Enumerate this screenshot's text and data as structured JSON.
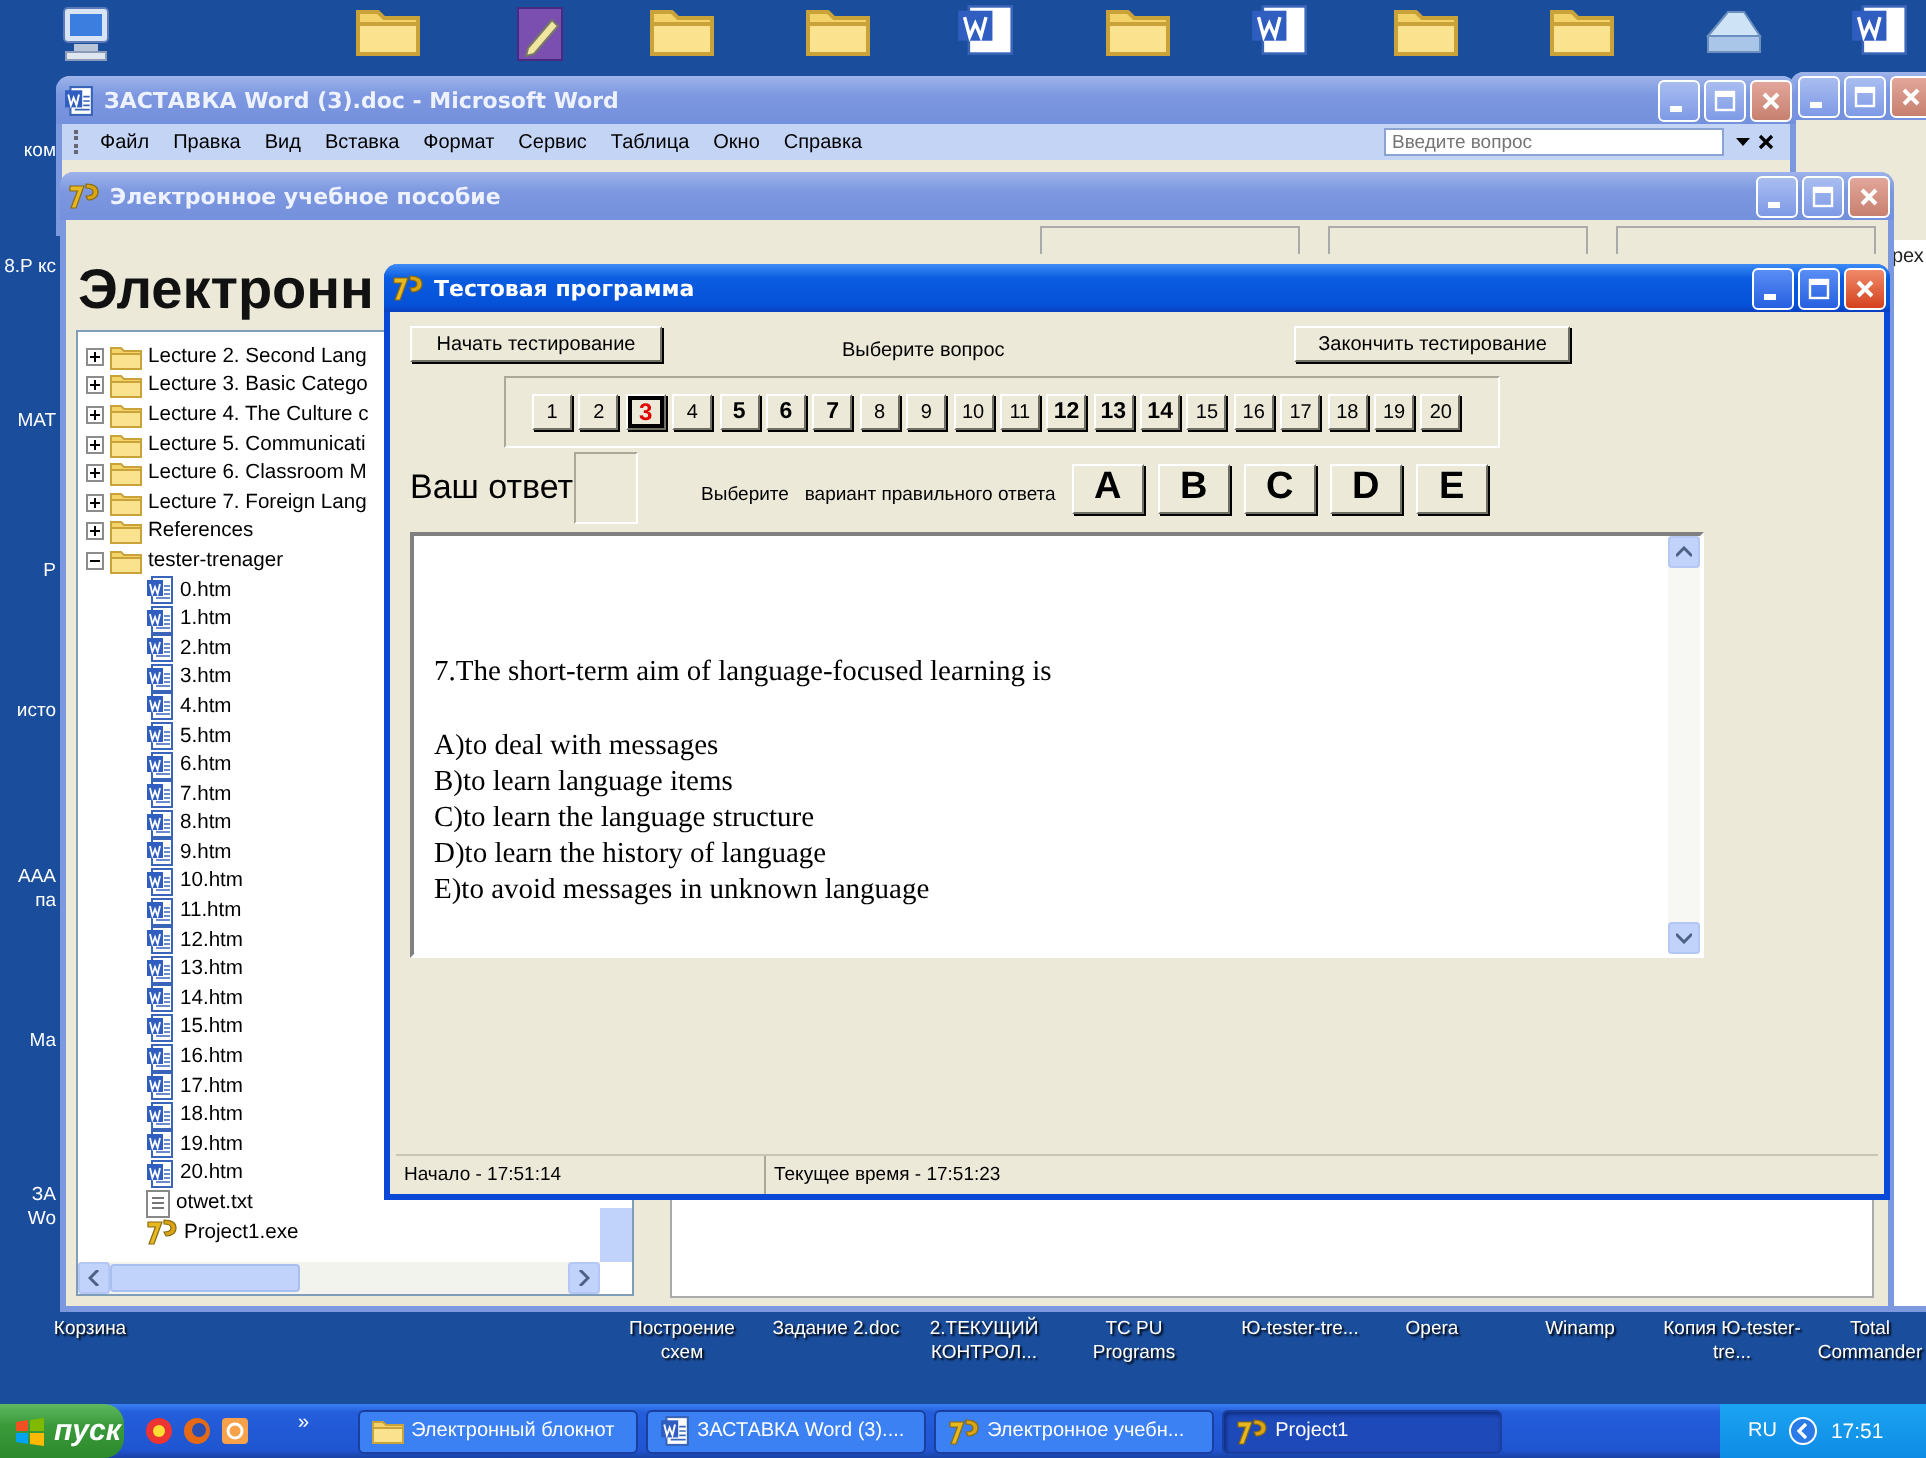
{
  "desktop": {
    "top_icons": [
      {
        "kind": "computer"
      },
      {
        "kind": "folder"
      },
      {
        "kind": "notebook"
      },
      {
        "kind": "folder"
      },
      {
        "kind": "folder"
      },
      {
        "kind": "word"
      },
      {
        "kind": "folder"
      },
      {
        "kind": "word"
      },
      {
        "kind": "folder"
      },
      {
        "kind": "folder"
      },
      {
        "kind": "drive"
      },
      {
        "kind": "word"
      }
    ],
    "left_labels": [
      "ком",
      "8.Р кс",
      "МАТ",
      "Р",
      "исто",
      "ААА па",
      "Ма",
      "ЗА Wo"
    ],
    "right_label": "рех",
    "bottom_labels": [
      "Корзина",
      "Построение схем",
      "Задание 2.doc",
      "2.ТЕКУЩИЙ КОНТРОЛ...",
      "TC PU Programs",
      "Ю-tester-tre...",
      "Opera",
      "Winamp",
      "Копия Ю-tester-tre...",
      "Total Commander"
    ]
  },
  "back_window": {
    "active": false
  },
  "word_window": {
    "title": "ЗАСТАВКА Word (3).doc - Microsoft Word",
    "active": false,
    "menu": [
      "Файл",
      "Правка",
      "Вид",
      "Вставка",
      "Формат",
      "Сервис",
      "Таблица",
      "Окно",
      "Справка"
    ],
    "help_placeholder": "Введите вопрос"
  },
  "textbook_window": {
    "title": "Электронное учебное пособие",
    "active": false,
    "heading": "Электронн",
    "tree": [
      {
        "label": "Lecture 2. Second Lang",
        "kind": "folder",
        "expanded": false
      },
      {
        "label": "Lecture 3. Basic Catego",
        "kind": "folder",
        "expanded": false
      },
      {
        "label": "Lecture 4. The Culture c",
        "kind": "folder",
        "expanded": false
      },
      {
        "label": "Lecture 5. Communicati",
        "kind": "folder",
        "expanded": false
      },
      {
        "label": "Lecture 6. Classroom M",
        "kind": "folder",
        "expanded": false
      },
      {
        "label": "Lecture 7. Foreign Lang",
        "kind": "folder",
        "expanded": false
      },
      {
        "label": "References",
        "kind": "folder",
        "expanded": false
      },
      {
        "label": "tester-trenager",
        "kind": "folder",
        "expanded": true,
        "children": [
          {
            "label": "0.htm",
            "kind": "doc"
          },
          {
            "label": "1.htm",
            "kind": "doc"
          },
          {
            "label": "2.htm",
            "kind": "doc"
          },
          {
            "label": "3.htm",
            "kind": "doc"
          },
          {
            "label": "4.htm",
            "kind": "doc"
          },
          {
            "label": "5.htm",
            "kind": "doc"
          },
          {
            "label": "6.htm",
            "kind": "doc"
          },
          {
            "label": "7.htm",
            "kind": "doc"
          },
          {
            "label": "8.htm",
            "kind": "doc"
          },
          {
            "label": "9.htm",
            "kind": "doc"
          },
          {
            "label": "10.htm",
            "kind": "doc"
          },
          {
            "label": "11.htm",
            "kind": "doc"
          },
          {
            "label": "12.htm",
            "kind": "doc"
          },
          {
            "label": "13.htm",
            "kind": "doc"
          },
          {
            "label": "14.htm",
            "kind": "doc"
          },
          {
            "label": "15.htm",
            "kind": "doc"
          },
          {
            "label": "16.htm",
            "kind": "doc"
          },
          {
            "label": "17.htm",
            "kind": "doc"
          },
          {
            "label": "18.htm",
            "kind": "doc"
          },
          {
            "label": "19.htm",
            "kind": "doc"
          },
          {
            "label": "20.htm",
            "kind": "doc"
          },
          {
            "label": "otwet.txt",
            "kind": "text"
          },
          {
            "label": "Project1.exe",
            "kind": "app"
          }
        ]
      }
    ]
  },
  "test_window": {
    "title": "Тестовая программа",
    "active": true,
    "start_button": "Начать тестирование",
    "choose_question": "Выберите вопрос",
    "finish_button": "Закончить тестирование",
    "questions": [
      {
        "label": "1",
        "selected": false,
        "answered": false
      },
      {
        "label": "2",
        "selected": false,
        "answered": false
      },
      {
        "label": "3",
        "selected": true,
        "answered": false
      },
      {
        "label": "4",
        "selected": false,
        "answered": false
      },
      {
        "label": "5",
        "selected": false,
        "answered": true
      },
      {
        "label": "6",
        "selected": false,
        "answered": true
      },
      {
        "label": "7",
        "selected": false,
        "answered": true
      },
      {
        "label": "8",
        "selected": false,
        "answered": false
      },
      {
        "label": "9",
        "selected": false,
        "answered": false
      },
      {
        "label": "10",
        "selected": false,
        "answered": false
      },
      {
        "label": "11",
        "selected": false,
        "answered": false
      },
      {
        "label": "12",
        "selected": false,
        "answered": true
      },
      {
        "label": "13",
        "selected": false,
        "answered": true
      },
      {
        "label": "14",
        "selected": false,
        "answered": true
      },
      {
        "label": "15",
        "selected": false,
        "answered": false
      },
      {
        "label": "16",
        "selected": false,
        "answered": false
      },
      {
        "label": "17",
        "selected": false,
        "answered": false
      },
      {
        "label": "18",
        "selected": false,
        "answered": false
      },
      {
        "label": "19",
        "selected": false,
        "answered": false
      },
      {
        "label": "20",
        "selected": false,
        "answered": false
      }
    ],
    "answer_label": "Ваш ответ",
    "choose_answer": "Выберите   вариант правильного ответа",
    "answer_buttons": [
      "A",
      "B",
      "C",
      "D",
      "E"
    ],
    "question": "7.The short-term aim of language-focused learning is",
    "options": [
      "A)to deal with messages",
      "B)to learn language items",
      "C)to learn the language structure",
      "D)to learn the history of language",
      "E)to avoid messages in unknown language"
    ],
    "status": [
      "Начало - 17:51:14",
      "Текущее время - 17:51:23"
    ]
  },
  "taskbar": {
    "start": "пуск",
    "more": "»",
    "tasks": [
      {
        "label": "Электронный блокнот",
        "kind": "folder",
        "selected": false
      },
      {
        "label": "ЗАСТАВКА Word (3)....",
        "kind": "word",
        "selected": false
      },
      {
        "label": "Электронное учебн...",
        "kind": "app",
        "selected": false
      },
      {
        "label": "Project1",
        "kind": "app",
        "selected": true
      }
    ],
    "language": "RU",
    "clock": "17:51"
  }
}
